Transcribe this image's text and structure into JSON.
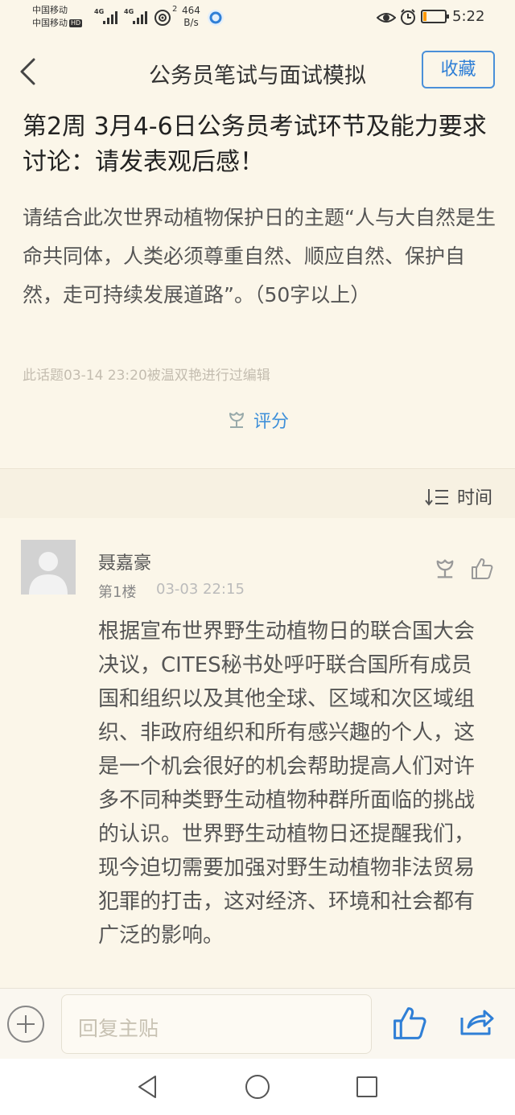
{
  "status_bar": {
    "carrier_1": "中国移动",
    "carrier_2": "中国移动",
    "hd_badge": "HD",
    "network_1": "4G",
    "network_2": "4G",
    "wifi_calls": "2",
    "net_speed_value": "464",
    "net_speed_unit": "B/s",
    "battery_level": 0.15,
    "battery_color": "#ff9800",
    "time": "5:22"
  },
  "header": {
    "back_icon": "chevron-left-icon",
    "title": "公务员笔试与面试模拟",
    "favorite_label": "收藏",
    "accent_color": "#2f7fd6"
  },
  "topic": {
    "title": "第2周 3月4-6日公务员考试环节及能力要求讨论：请发表观后感！",
    "body": "请结合此次世界动植物保护日的主题“人与大自然是生命共同体，人类必须尊重自然、顺应自然、保护自然，走可持续发展道路”。（50字以上）",
    "edit_note": "此话题03-14 23:20被温双艳进行过编辑",
    "rate_label": "评分"
  },
  "sort": {
    "label": "时间"
  },
  "post": {
    "author": "聂嘉豪",
    "floor": "第1楼",
    "time": "03-03 22:15",
    "body": "根据宣布世界野生动植物日的联合国大会决议，CITES秘书处呼吁联合国所有成员国和组织以及其他全球、区域和次区域组织、非政府组织和所有感兴趣的个人，这是一个机会很好的机会帮助提高人们对许多不同种类野生动植物种群所面临的挑战的认识。世界野生动植物日还提醒我们，现今迫切需要加强对野生动植物非法贸易犯罪的打击，这对经济、环境和社会都有广泛的影响。"
  },
  "reply_bar": {
    "placeholder": "回复主贴"
  }
}
